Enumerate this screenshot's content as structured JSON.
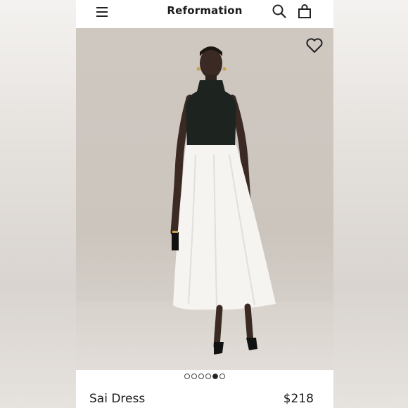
{
  "header": {
    "brand": "Reformation",
    "menu_icon": "hamburger-menu-icon",
    "search_icon": "search-icon",
    "bag_icon": "shopping-bag-icon"
  },
  "gallery": {
    "favorite_icon": "heart-icon",
    "image_count": 6,
    "active_index": 4,
    "image_subject": "model wearing black sleeveless mock-neck top and white full midi skirt dress"
  },
  "product": {
    "name": "Sai Dress",
    "price": "$218"
  },
  "colors": {
    "text": "#1c1c1c",
    "background": "#ffffff",
    "photo_backdrop": "#cfc8c1"
  }
}
